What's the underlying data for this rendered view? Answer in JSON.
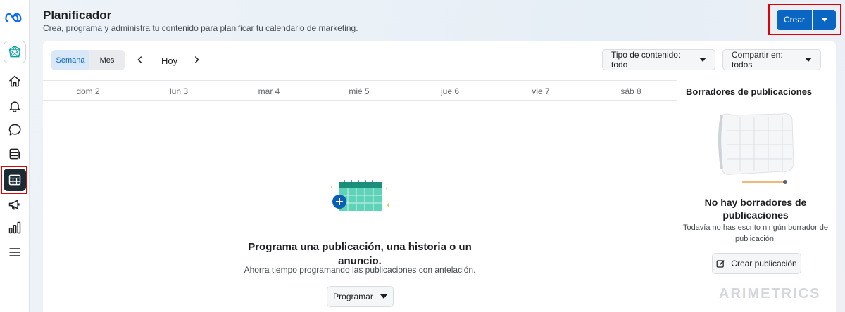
{
  "sidebar": {
    "items": [
      {
        "name": "meta-logo-icon"
      },
      {
        "name": "business-suite-icon"
      },
      {
        "name": "home-icon"
      },
      {
        "name": "notifications-icon"
      },
      {
        "name": "inbox-icon"
      },
      {
        "name": "content-icon"
      },
      {
        "name": "planner-icon",
        "active": true
      },
      {
        "name": "ads-icon"
      },
      {
        "name": "insights-icon"
      },
      {
        "name": "menu-icon"
      }
    ]
  },
  "header": {
    "title": "Planificador",
    "subtitle": "Crea, programa y administra tu contenido para planificar tu calendario de marketing.",
    "create_label": "Crear"
  },
  "toolbar": {
    "tabs": [
      {
        "label": "Semana",
        "active": true
      },
      {
        "label": "Mes",
        "active": false
      }
    ],
    "today_label": "Hoy",
    "content_type_filter": "Tipo de contenido: todo",
    "share_filter": "Compartir en: todos"
  },
  "calendar": {
    "days": [
      "dom 2",
      "lun 3",
      "mar 4",
      "mié 5",
      "jue 6",
      "vie 7",
      "sáb 8"
    ],
    "empty_title": "Programa una publicación, una historia o un anuncio.",
    "empty_subtitle": "Ahorra tiempo programando las publicaciones con antelación.",
    "schedule_label": "Programar"
  },
  "drafts": {
    "title": "Borradores de publicaciones",
    "empty_title": "No hay borradores de publicaciones",
    "empty_subtitle": "Todavía no has escrito ningún borrador de publicación.",
    "create_post_label": "Crear publicación"
  },
  "watermark": "ARIMETRICS",
  "colors": {
    "accent": "#0a66c2",
    "highlight_box": "#e00000",
    "active_sidebar": "#1c2b33"
  }
}
